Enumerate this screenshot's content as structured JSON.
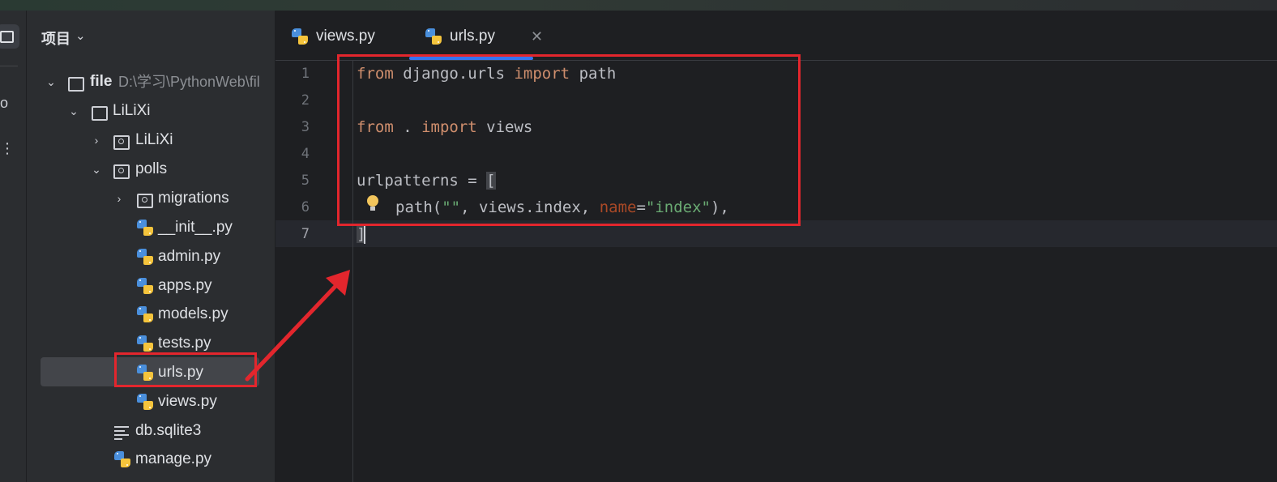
{
  "sidebar_icons": [
    "folder-icon",
    "structure-icon",
    "more-icon"
  ],
  "project_panel": {
    "title": "项目",
    "tree": [
      {
        "name": "file",
        "path": "D:\\学习\\PythonWeb\\fil",
        "type": "folder",
        "expanded": true
      },
      {
        "name": "LiLiXi",
        "type": "folder",
        "expanded": true
      },
      {
        "name": "LiLiXi",
        "type": "module-folder",
        "expanded": false
      },
      {
        "name": "polls",
        "type": "module-folder",
        "expanded": true
      },
      {
        "name": "migrations",
        "type": "module-folder",
        "expanded": false
      },
      {
        "name": "__init__.py",
        "type": "python"
      },
      {
        "name": "admin.py",
        "type": "python"
      },
      {
        "name": "apps.py",
        "type": "python"
      },
      {
        "name": "models.py",
        "type": "python"
      },
      {
        "name": "tests.py",
        "type": "python"
      },
      {
        "name": "urls.py",
        "type": "python",
        "selected": true
      },
      {
        "name": "views.py",
        "type": "python"
      },
      {
        "name": "db.sqlite3",
        "type": "text"
      },
      {
        "name": "manage.py",
        "type": "python"
      }
    ]
  },
  "tabs": [
    {
      "label": "views.py",
      "active": false
    },
    {
      "label": "urls.py",
      "active": true
    }
  ],
  "editor": {
    "line_numbers": [
      "1",
      "2",
      "3",
      "4",
      "5",
      "6",
      "7"
    ],
    "current_line": "7",
    "code": {
      "l1_from": "from",
      "l1_mod": " django.urls ",
      "l1_import": "import",
      "l1_name": " path",
      "l3_from": "from",
      "l3_dot": " . ",
      "l3_import": "import",
      "l3_name": " views",
      "l5_a": "urlpatterns = ",
      "l5_b": "[",
      "l6_a": "path(",
      "l6_str1": "\"\"",
      "l6_b": ", views.index, ",
      "l6_param": "name",
      "l6_eq": "=",
      "l6_str2": "\"index\"",
      "l6_c": "),",
      "l7_a": "]"
    }
  },
  "colors": {
    "keyword": "#cf8e6d",
    "string": "#6aab73",
    "param": "#aa4926",
    "annotation": "#e3262d",
    "tab_active": "#3574f0"
  }
}
